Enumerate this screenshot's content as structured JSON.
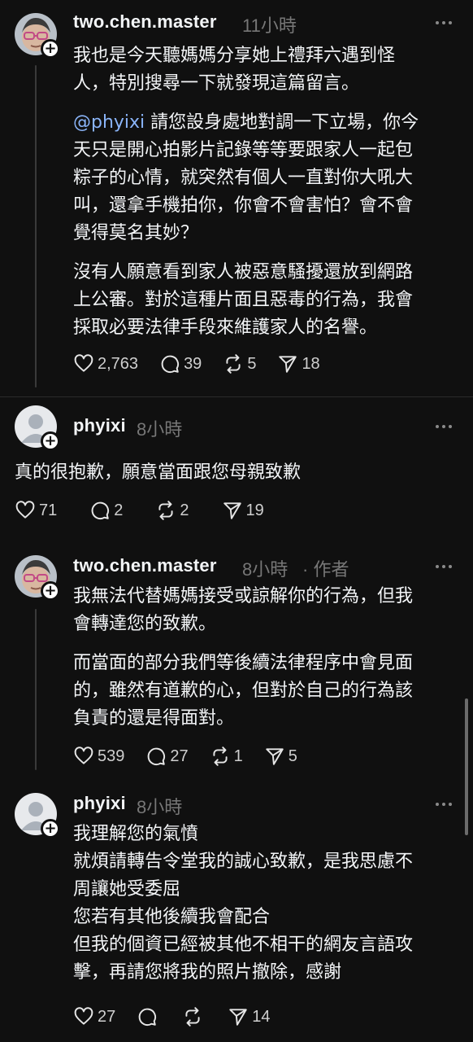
{
  "posts": [
    {
      "username": "two.chen.master",
      "time": "11小時",
      "author_tag": "",
      "paragraphs": [
        "我也是今天聽媽媽分享她上禮拜六遇到怪\n人，特別搜尋一下就發現這篇留言。",
        "請您設身處地對調一下立場，你今\n天只是開心拍影片記錄等等要跟家人一起包\n粽子的心情，就突然有個人一直對你大吼大\n叫，還拿手機拍你，你會不會害怕？會不會\n覺得莫名其妙？",
        "沒有人願意看到家人被惡意騷擾還放到網路\n上公審。對於這種片面且惡毒的行為，我會\n採取必要法律手段來維護家人的名譽。"
      ],
      "mention": "@phyixi",
      "stats": {
        "likes": "2,763",
        "comments": "39",
        "reposts": "5",
        "shares": "18"
      }
    },
    {
      "username": "phyixi",
      "time": "8小時",
      "author_tag": "",
      "paragraphs": [
        "真的很抱歉，願意當面跟您母親致歉"
      ],
      "stats": {
        "likes": "71",
        "comments": "2",
        "reposts": "2",
        "shares": "19"
      }
    },
    {
      "username": "two.chen.master",
      "time": "8小時",
      "author_tag": "· 作者",
      "paragraphs": [
        "我無法代替媽媽接受或諒解你的行為，但我\n會轉達您的致歉。",
        "而當面的部分我們等後續法律程序中會見面\n的，雖然有道歉的心，但對於自己的行為該\n負責的還是得面對。"
      ],
      "stats": {
        "likes": "539",
        "comments": "27",
        "reposts": "1",
        "shares": "5"
      }
    },
    {
      "username": "phyixi",
      "time": "8小時",
      "author_tag": "",
      "paragraphs": [
        "我理解您的氣憤\n就煩請轉告令堂我的誠心致歉，是我思慮不\n周讓她受委屈\n您若有其他後續我會配合\n但我的個資已經被其他不相干的網友言語攻\n擊，再請您將我的照片撤除，感謝"
      ],
      "stats": {
        "likes": "27",
        "comments": "",
        "reposts": "",
        "shares": "14"
      }
    }
  ],
  "icons": {
    "like": "heart-icon",
    "comment": "comment-bubble-icon",
    "repost": "repost-icon",
    "share": "send-icon",
    "more": "more-dots-icon",
    "follow": "plus-icon"
  },
  "colors": {
    "background": "#101010",
    "text": "#f3f5f7",
    "secondary": "#777777",
    "mention": "#8ab4f8",
    "thread_line": "#3a3a3a"
  }
}
